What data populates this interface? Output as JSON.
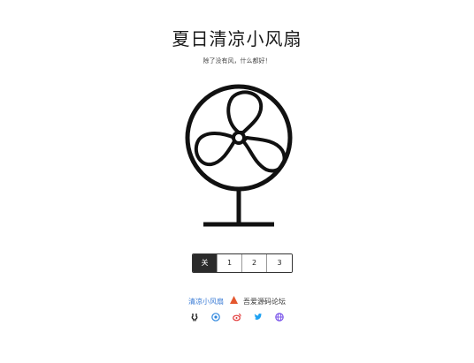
{
  "header": {
    "title": "夏日清凉小风扇",
    "subtitle": "除了没有风，什么都好！"
  },
  "fan": {
    "icon": "electric-fan-icon",
    "current_speed": "关"
  },
  "speed_buttons": [
    {
      "label": "关",
      "active": true
    },
    {
      "label": "1",
      "active": false
    },
    {
      "label": "2",
      "active": false
    },
    {
      "label": "3",
      "active": false
    }
  ],
  "footer": {
    "project_link": "清凉小风扇",
    "separator_icon": "water-drop-icon",
    "site_name": "吾爱源码论坛",
    "icons": [
      "github-icon",
      "qq-icon",
      "weibo-icon",
      "twitter-icon",
      "globe-icon"
    ],
    "accent_color": "#3a7bd5",
    "drop_color": "#e4572e"
  }
}
